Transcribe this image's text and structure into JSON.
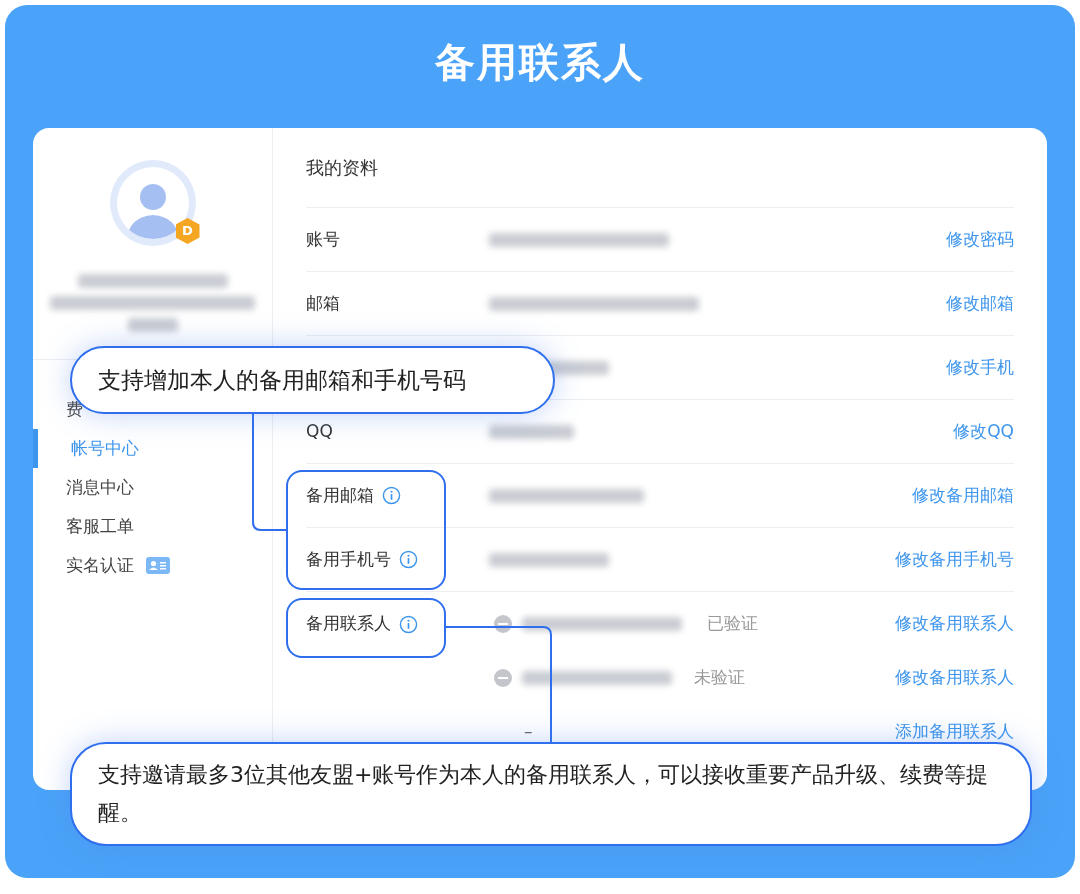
{
  "title": "备用联系人",
  "sidebar": {
    "badge": "D",
    "items": [
      {
        "label": "费",
        "selected": false
      },
      {
        "label": "帐号中心",
        "selected": true
      },
      {
        "label": "消息中心",
        "selected": false
      },
      {
        "label": "客服工单",
        "selected": false
      },
      {
        "label": "实名认证",
        "selected": false,
        "kind": "verify"
      }
    ]
  },
  "profile": {
    "heading": "我的资料",
    "rows": [
      {
        "label": "账号",
        "action": "修改密码"
      },
      {
        "label": "邮箱",
        "action": "修改邮箱"
      },
      {
        "action": "修改手机"
      },
      {
        "label": "QQ",
        "action": "修改QQ"
      },
      {
        "label": "备用邮箱",
        "info": true,
        "action": "修改备用邮箱"
      },
      {
        "label": "备用手机号",
        "info": true,
        "action": "修改备用手机号"
      }
    ],
    "contacts": {
      "label": "备用联系人",
      "info": true,
      "items": [
        {
          "kind": "contact",
          "status": "已验证",
          "action": "修改备用联系人"
        },
        {
          "kind": "contact",
          "status": "未验证",
          "action": "修改备用联系人"
        },
        {
          "kind": "add",
          "dash": "–",
          "action": "添加备用联系人"
        }
      ]
    }
  },
  "callouts": [
    "支持增加本人的备用邮箱和手机号码",
    "支持邀请最多3位其他友盟+账号作为本人的备用联系人，可以接收重要产品升级、续费等提醒。"
  ]
}
